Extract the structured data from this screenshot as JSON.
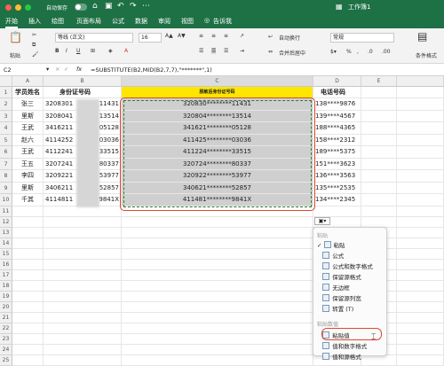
{
  "titlebar": {
    "autosave": "自动保存",
    "doc": "工作簿1",
    "colors": {
      "close": "#ff5f57",
      "min": "#febc2e",
      "max": "#28c840"
    }
  },
  "tabs": [
    "开始",
    "插入",
    "绘图",
    "页面布局",
    "公式",
    "数据",
    "审阅",
    "视图",
    "告诉我"
  ],
  "ribbon": {
    "paste": "粘贴",
    "font": "等线 (正文)",
    "size": "16",
    "wrap": "自动换行",
    "merge": "合并后居中",
    "number_format": "常规",
    "cond": "条件格式"
  },
  "formula": {
    "cellref": "C2",
    "fx": "fx",
    "text": "=SUBSTITUTE(B2,MID(B2,7,7),\"*******\",1)"
  },
  "columns": [
    "A",
    "B",
    "C",
    "D",
    "E"
  ],
  "rows": [
    "1",
    "2",
    "3",
    "4",
    "5",
    "6",
    "7",
    "8",
    "9",
    "10",
    "11",
    "12",
    "13",
    "14",
    "15",
    "16",
    "17",
    "18",
    "19",
    "20",
    "21",
    "22",
    "23",
    "24",
    "25"
  ],
  "headers": {
    "a": "学员姓名",
    "b": "身份证号码",
    "c": "脱敏后身份证号码",
    "d": "电话号码"
  },
  "data": [
    {
      "a": "张三",
      "b1": "3208301",
      "b2": "11431",
      "c": "320830********11431",
      "d": "138****9876"
    },
    {
      "a": "里斯",
      "b1": "3208041",
      "b2": "13514",
      "c": "320804********13514",
      "d": "139****4567"
    },
    {
      "a": "王武",
      "b1": "3416211",
      "b2": "05128",
      "c": "341621********05128",
      "d": "188****4365"
    },
    {
      "a": "赵六",
      "b1": "4114252",
      "b2": "03036",
      "c": "411425********03036",
      "d": "158****2312"
    },
    {
      "a": "王武",
      "b1": "4112241",
      "b2": "33515",
      "c": "411224********33515",
      "d": "189****5375"
    },
    {
      "a": "王五",
      "b1": "3207241",
      "b2": "80337",
      "c": "320724********80337",
      "d": "151****3623"
    },
    {
      "a": "李四",
      "b1": "3209221",
      "b2": "53977",
      "c": "320922********53977",
      "d": "136****3563"
    },
    {
      "a": "里斯",
      "b1": "3406211",
      "b2": "52857",
      "d": "135****2535",
      "c": "340621********52857"
    },
    {
      "a": "千其",
      "b1": "4114811",
      "b2": "9841X",
      "c": "411481********9841X",
      "d": "134****2345"
    }
  ],
  "pastemenu": {
    "group1": "粘贴",
    "items": [
      "粘贴",
      "公式",
      "公式和数字格式",
      "保留源格式",
      "无边框",
      "保留源列宽",
      "转置 (T)"
    ],
    "group2": "粘贴数值",
    "items2": [
      "粘贴值",
      "值和数字格式",
      "值和源格式"
    ]
  }
}
